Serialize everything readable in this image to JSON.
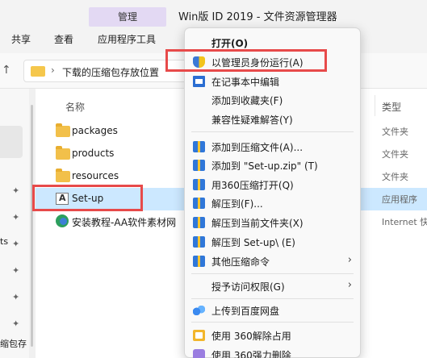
{
  "window": {
    "context_tab": "管理",
    "title": "Win版 ID 2019 - 文件资源管理器"
  },
  "ribbon": {
    "tabs": [
      "共享",
      "查看",
      "应用程序工具"
    ]
  },
  "address": {
    "separator": "›",
    "path": "下载的压缩包存放位置",
    "trailing": "V"
  },
  "leftnav": {
    "fragments": [
      "ts",
      "缩包存"
    ],
    "pin_glyph": "✦"
  },
  "columns": {
    "name": "名称",
    "type": "类型"
  },
  "files": [
    {
      "name": "packages",
      "type": "文件夹",
      "icon": "folder-icon"
    },
    {
      "name": "products",
      "type": "文件夹",
      "icon": "folder-icon"
    },
    {
      "name": "resources",
      "type": "文件夹",
      "icon": "folder-icon"
    },
    {
      "name": "Set-up",
      "type": "应用程序",
      "icon": "setup-exe-icon",
      "selected": true
    },
    {
      "name": "安装教程-AA软件素材网",
      "type": "Internet 快",
      "icon": "internet-shortcut-icon"
    }
  ],
  "context_menu": {
    "items": [
      {
        "label": "打开(O)",
        "bold": true,
        "icon": ""
      },
      {
        "label": "以管理员身份运行(A)",
        "icon": "uac-shield-icon",
        "highlighted": true
      },
      {
        "label": "在记事本中编辑",
        "icon": "notepad-icon"
      },
      {
        "label": "添加到收藏夹(F)",
        "icon": ""
      },
      {
        "label": "兼容性疑难解答(Y)",
        "icon": ""
      },
      {
        "label": "添加到压缩文件(A)...",
        "icon": "archive-icon"
      },
      {
        "label": "添加到 \"Set-up.zip\" (T)",
        "icon": "archive-icon"
      },
      {
        "label": "用360压缩打开(Q)",
        "icon": "archive-icon"
      },
      {
        "label": "解压到(F)...",
        "icon": "archive-icon"
      },
      {
        "label": "解压到当前文件夹(X)",
        "icon": "archive-icon"
      },
      {
        "label": "解压到 Set-up\\ (E)",
        "icon": "archive-icon"
      },
      {
        "label": "其他压缩命令",
        "icon": "archive-icon",
        "submenu": true
      },
      {
        "label": "授予访问权限(G)",
        "icon": "",
        "submenu": true
      },
      {
        "label": "上传到百度网盘",
        "icon": "baidu-netdisk-icon"
      },
      {
        "label": "使用 360解除占用",
        "icon": "360-unlock-icon"
      },
      {
        "label": "使用 360强力删除",
        "icon": "360-delete-icon"
      }
    ],
    "submenu_arrow": "›"
  },
  "colors": {
    "highlight_box": "#e74a4a",
    "selection": "#cce8ff",
    "context_tab_bg": "#e3d9f3"
  }
}
